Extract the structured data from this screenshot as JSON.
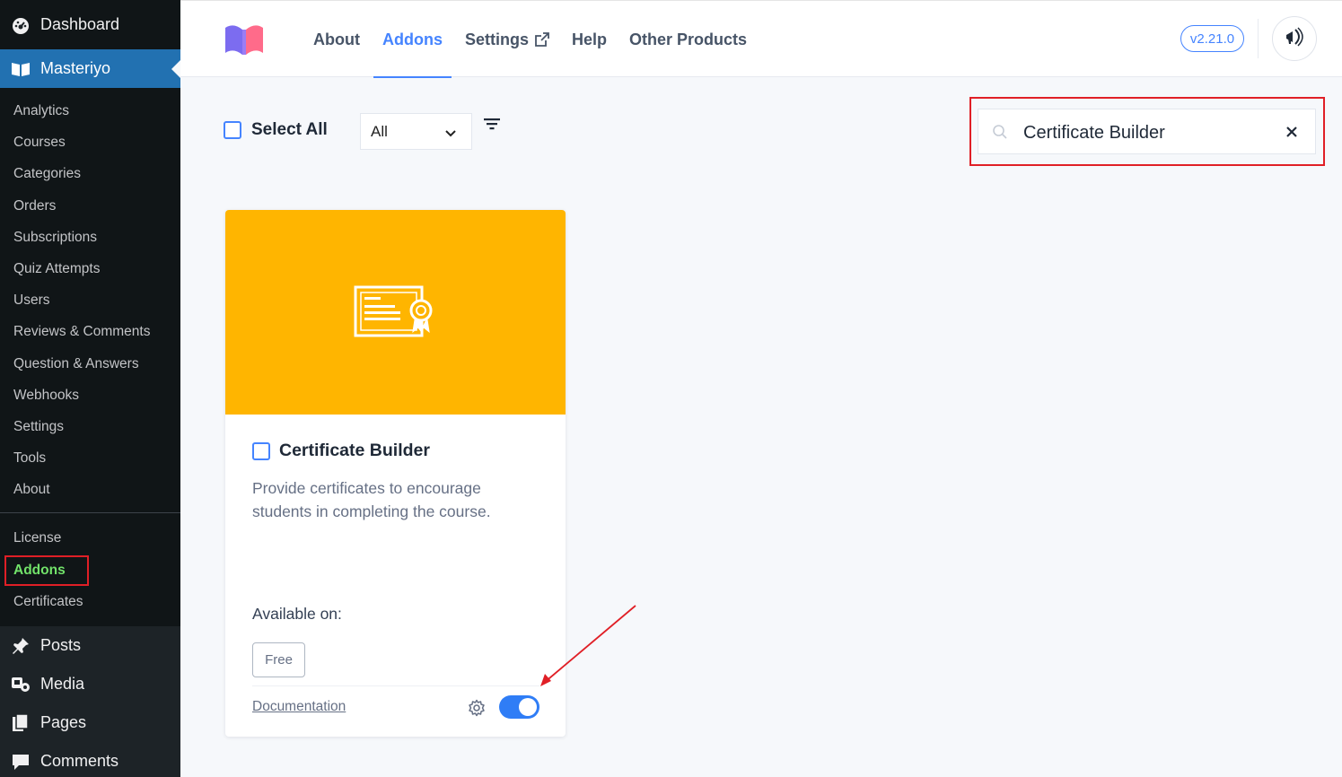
{
  "wp_sidebar": {
    "dashboard_label": "Dashboard",
    "current_label": "Masteriyo",
    "submenu": [
      "Analytics",
      "Courses",
      "Categories",
      "Orders",
      "Subscriptions",
      "Quiz Attempts",
      "Users",
      "Reviews & Comments",
      "Question & Answers",
      "Webhooks",
      "Settings",
      "Tools",
      "About"
    ],
    "submenu2": {
      "license": "License",
      "addons": "Addons",
      "certificates": "Certificates"
    },
    "main_items": [
      {
        "label": "Posts",
        "icon": "pin-icon"
      },
      {
        "label": "Media",
        "icon": "media-icon"
      },
      {
        "label": "Pages",
        "icon": "pages-icon"
      },
      {
        "label": "Comments",
        "icon": "comments-icon"
      }
    ]
  },
  "header": {
    "nav": {
      "about": "About",
      "addons": "Addons",
      "settings": "Settings",
      "help": "Help",
      "other_products": "Other Products"
    },
    "version": "v2.21.0"
  },
  "toolbar": {
    "select_all": "Select All",
    "filter_value": "All",
    "search_value": "Certificate Builder"
  },
  "addon_card": {
    "title": "Certificate Builder",
    "description": "Provide certificates to encourage students in completing the course.",
    "available_on_label": "Available on:",
    "plan_badge": "Free",
    "documentation_label": "Documentation",
    "enabled": true,
    "banner_color": "#ffb500"
  },
  "colors": {
    "accent": "#4584ff",
    "wp_sidebar": "#1d2327",
    "wp_current": "#2271b1",
    "highlight": "#e01f26",
    "active_addons": "#72e36a"
  }
}
